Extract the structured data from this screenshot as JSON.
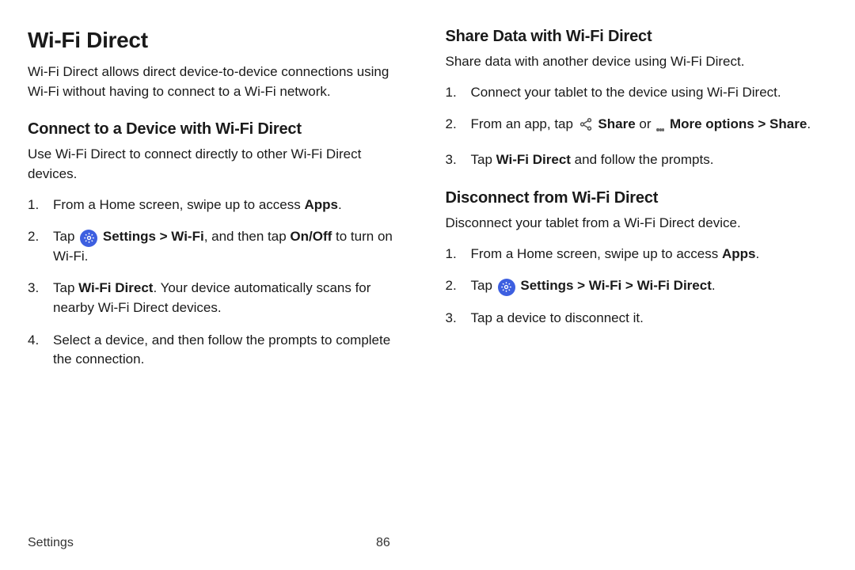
{
  "left": {
    "h1": "Wi-Fi Direct",
    "intro": "Wi-Fi Direct allows direct device-to-device connections using Wi-Fi without having to connect to a Wi-Fi network.",
    "connect": {
      "h2": "Connect to a Device with Wi-Fi Direct",
      "intro": "Use Wi-Fi Direct to connect directly to other Wi‑Fi Direct devices.",
      "steps": {
        "s1_a": "From a Home screen, swipe up to access ",
        "s1_b": "Apps",
        "s1_c": ".",
        "s2_a": "Tap ",
        "s2_b": "Settings > Wi-Fi",
        "s2_c": ", and then tap ",
        "s2_d": "On/Off",
        "s2_e": " to turn on Wi-Fi.",
        "s3_a": "Tap ",
        "s3_b": "Wi-Fi Direct",
        "s3_c": ". Your device automatically scans for nearby Wi-Fi Direct devices.",
        "s4": "Select a device, and then follow the prompts to complete the connection."
      }
    }
  },
  "right": {
    "share": {
      "h2": "Share Data with Wi-Fi Direct",
      "intro": "Share data with another device using Wi-Fi Direct.",
      "steps": {
        "s1": "Connect your tablet to the device using Wi-Fi Direct.",
        "s2_a": "From an app, tap ",
        "s2_b": "Share",
        "s2_c": " or ",
        "s2_d": "More options > Share",
        "s2_e": ".",
        "s3_a": "Tap ",
        "s3_b": "Wi-Fi Direct",
        "s3_c": " and follow the prompts."
      }
    },
    "disconnect": {
      "h2": "Disconnect from Wi-Fi Direct",
      "intro": "Disconnect your tablet from a Wi-Fi Direct device.",
      "steps": {
        "s1_a": "From a Home screen, swipe up to access ",
        "s1_b": "Apps",
        "s1_c": ".",
        "s2_a": "Tap ",
        "s2_b": "Settings > Wi-Fi > Wi-Fi Direct",
        "s2_c": ".",
        "s3": "Tap a device to disconnect it."
      }
    }
  },
  "footer": {
    "section": "Settings",
    "page": "86"
  }
}
